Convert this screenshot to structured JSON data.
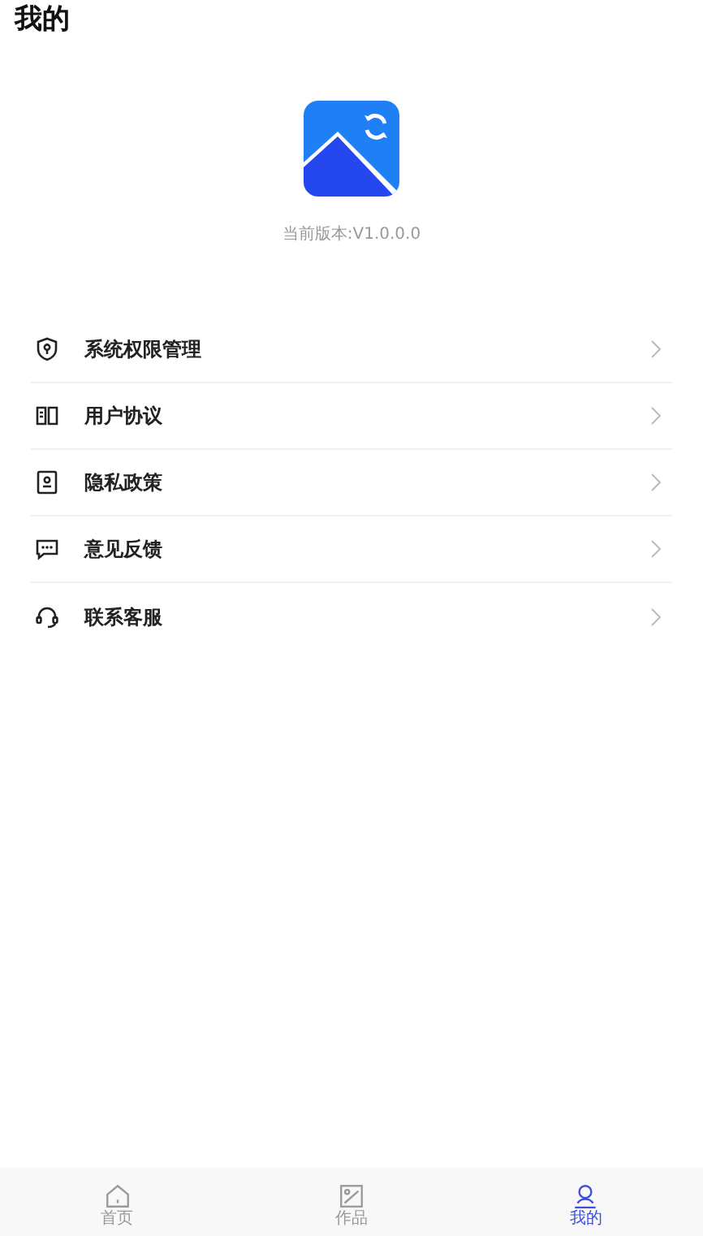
{
  "header": {
    "title": "我的"
  },
  "app": {
    "version": "当前版本:V1.0.0.0"
  },
  "menu": [
    {
      "kind": "shield",
      "label": "系统权限管理"
    },
    {
      "kind": "book",
      "label": "用户协议"
    },
    {
      "kind": "badge",
      "label": "隐私政策"
    },
    {
      "kind": "chat",
      "label": "意见反馈"
    },
    {
      "kind": "headset",
      "label": "联系客服"
    }
  ],
  "tabs": [
    {
      "kind": "home",
      "label": "首页",
      "selected": false
    },
    {
      "kind": "image",
      "label": "作品",
      "selected": false
    },
    {
      "kind": "user",
      "label": "我的",
      "selected": true
    }
  ]
}
